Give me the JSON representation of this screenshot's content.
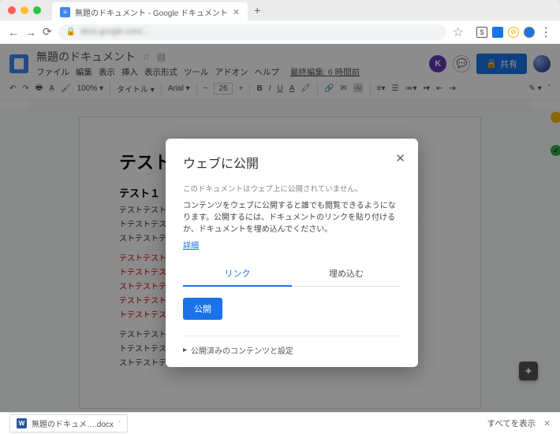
{
  "browser": {
    "tab_title": "無題のドキュメント - Google ドキュメント",
    "url_display_blur": "docs.google.com/..."
  },
  "header": {
    "doc_title": "無題のドキュメント",
    "menus": [
      "ファイル",
      "編集",
      "表示",
      "挿入",
      "表示形式",
      "ツール",
      "アドオン",
      "ヘルプ"
    ],
    "last_edit": "最終編集: 6 時間前",
    "avatar_letter": "K",
    "share_label": "共有"
  },
  "toolbar": {
    "zoom": "100%",
    "style": "タイトル",
    "font": "Arial",
    "font_size": "26"
  },
  "document": {
    "heading": "テスト",
    "subheading": "テスト１",
    "block1": [
      "テストテストテストテストテストテストテストテストテストテストテストテストテス",
      "トテストテストテストテストテストテストテストテストテストテストテストテストテ",
      "ストテストテストテスト"
    ],
    "block2_red": [
      "テストテストテストテストテストテストテストテストテストテストテストテストテス",
      "トテストテストテストテストテストテストテストテストテストテストテストテストテ",
      "ストテストテストテストテストテストテストテストテストテストテストテストテスト",
      "テストテストテストテストテストテストテストテストテストテストテストテストテス",
      "トテストテストテスト"
    ],
    "block3": [
      "テストテストテストテストテストテストテストテストテストテストテストテストテス",
      "トテストテストテストテストテストテストテストテストテストテストテストテストテ",
      "ストテストテストテストテストテストテストテストテストテスト"
    ]
  },
  "dialog": {
    "title": "ウェブに公開",
    "msg_not_published": "このドキュメントはウェブ上に公開されていません。",
    "msg_desc": "コンテンツをウェブに公開すると誰でも閲覧できるようになります。公開するには、ドキュメントのリンクを貼り付けるか、ドキュメントを埋め込んでください。",
    "learn_more": "詳細",
    "tab_link": "リンク",
    "tab_embed": "埋め込む",
    "publish_button": "公開",
    "published_settings": "公開済みのコンテンツと設定"
  },
  "downloads": {
    "filename": "無題のドキュメ….docx",
    "show_all": "すべてを表示"
  }
}
